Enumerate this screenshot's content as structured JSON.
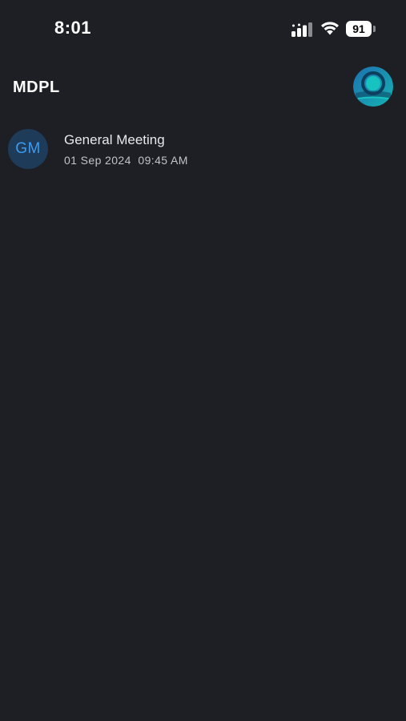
{
  "status_bar": {
    "time": "8:01",
    "battery_level": "91",
    "icons": [
      "signal-icon",
      "wifi-icon",
      "battery-icon"
    ]
  },
  "header": {
    "title": "MDPL",
    "avatar_icon": "profile-avatar-logo"
  },
  "meetings": [
    {
      "initials": "GM",
      "title": "General Meeting",
      "date": "01 Sep 2024",
      "time": "09:45 AM"
    }
  ],
  "colors": {
    "background": "#1e1f25",
    "initials_bg": "#1f3b5a",
    "initials_text": "#3b9bf0",
    "avatar_teal": "#14b3b3",
    "avatar_blue": "#1f6fb0"
  }
}
